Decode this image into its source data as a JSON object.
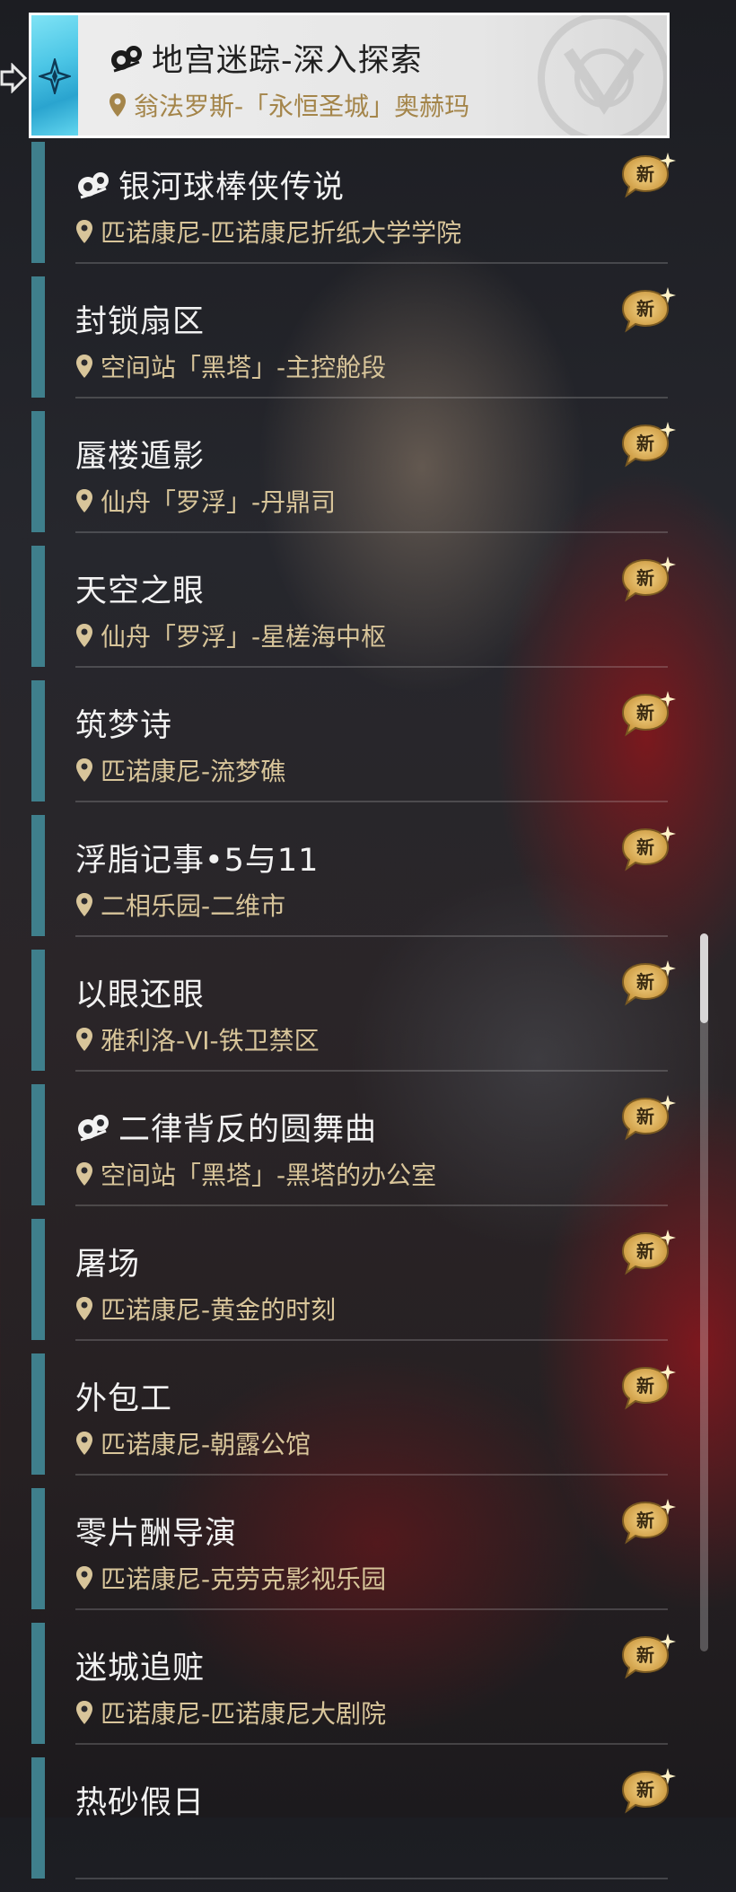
{
  "selected": {
    "title": "地宫迷踪-深入探索",
    "location": "翁法罗斯-「永恒圣城」奥赫玛",
    "icon": "swirl-icon"
  },
  "badge_label": "新",
  "items": [
    {
      "title": "银河球棒侠传说",
      "location": "匹诺康尼-匹诺康尼折纸大学学院",
      "has_icon": true
    },
    {
      "title": "封锁扇区",
      "location": "空间站「黑塔」-主控舱段",
      "has_icon": false
    },
    {
      "title": "蜃楼遁影",
      "location": "仙舟「罗浮」-丹鼎司",
      "has_icon": false
    },
    {
      "title": "天空之眼",
      "location": "仙舟「罗浮」-星槎海中枢",
      "has_icon": false
    },
    {
      "title": "筑梦诗",
      "location": "匹诺康尼-流梦礁",
      "has_icon": false
    },
    {
      "title": "浮脂记事•5与11",
      "location": "二相乐园-二维市",
      "has_icon": false
    },
    {
      "title": "以眼还眼",
      "location": "雅利洛-VI-铁卫禁区",
      "has_icon": false
    },
    {
      "title": "二律背反的圆舞曲",
      "location": "空间站「黑塔」-黑塔的办公室",
      "has_icon": true
    },
    {
      "title": "屠场",
      "location": "匹诺康尼-黄金的时刻",
      "has_icon": false
    },
    {
      "title": "外包工",
      "location": "匹诺康尼-朝露公馆",
      "has_icon": false
    },
    {
      "title": "零片酬导演",
      "location": "匹诺康尼-克劳克影视乐园",
      "has_icon": false
    },
    {
      "title": "迷城追赃",
      "location": "匹诺康尼-匹诺康尼大剧院",
      "has_icon": false
    },
    {
      "title": "热砂假日",
      "location": "",
      "has_icon": false
    }
  ]
}
